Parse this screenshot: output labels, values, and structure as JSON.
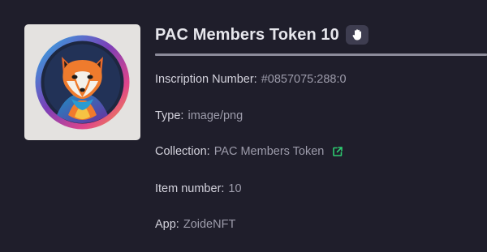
{
  "token": {
    "title": "PAC Members Token 10",
    "image_alt": "fox-logo-image"
  },
  "details": {
    "inscription_label": "Inscription Number:",
    "inscription_value": "#0857075:288:0",
    "type_label": "Type:",
    "type_value": "image/png",
    "collection_label": "Collection:",
    "collection_value": "PAC Members Token",
    "item_label": "Item number:",
    "item_value": "10",
    "app_label": "App:",
    "app_value": "ZoideNFT"
  },
  "icons": {
    "hand": "hand-icon",
    "external_link": "external-link-icon"
  },
  "colors": {
    "background": "#1f1e2b",
    "title": "#e6e6ec",
    "label": "#d3d2dc",
    "value": "#9d9cab",
    "link_icon": "#2ecc71",
    "divider": "#8c8b9a"
  }
}
